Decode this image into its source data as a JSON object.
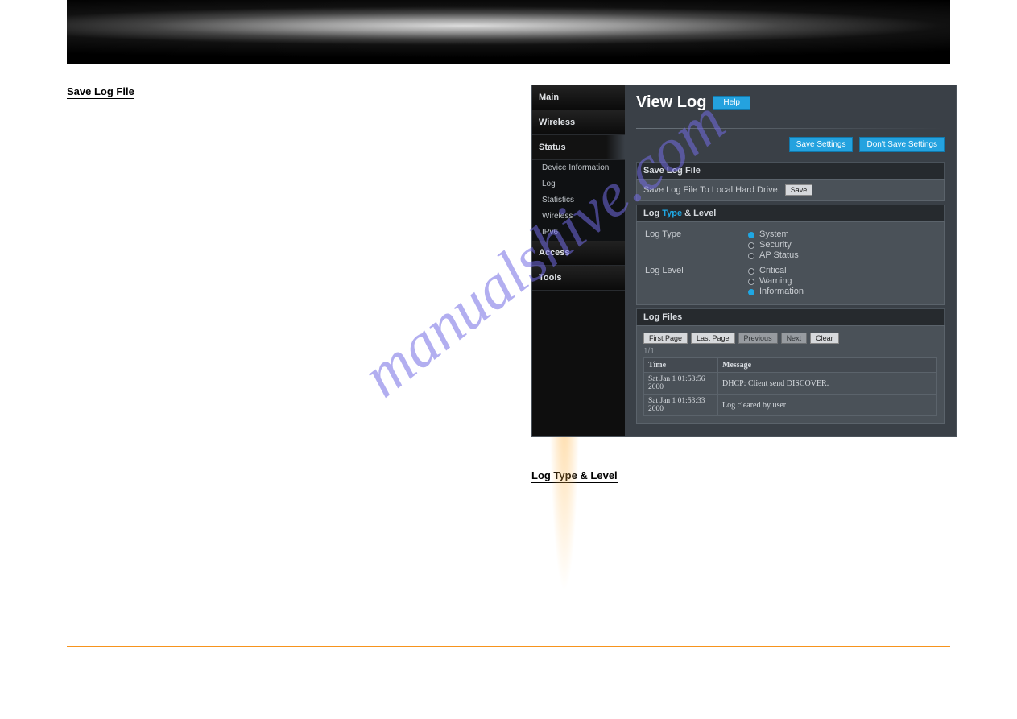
{
  "headings": {
    "left": "Save Log File",
    "right": "Log Type & Level"
  },
  "sidenav": {
    "main": "Main",
    "wireless": "Wireless",
    "status": "Status",
    "access": "Access",
    "tools": "Tools",
    "subs": {
      "device_info": "Device Information",
      "log": "Log",
      "statistics": "Statistics",
      "wireless": "Wireless",
      "ipv6": "IPv6"
    }
  },
  "ui": {
    "title": "View Log",
    "help": "Help",
    "save_settings": "Save Settings",
    "dont_save": "Don't Save Settings",
    "save_log_file_hdr": "Save Log File",
    "save_log_text": "Save Log File To Local Hard Drive.",
    "save_btn": "Save",
    "type_level_hdr_prefix": "Log ",
    "type_level_hdr_accent": "Type",
    "type_level_hdr_suffix": " & Level",
    "log_type_label": "Log Type",
    "log_level_label": "Log Level",
    "types": {
      "system": "System",
      "security": "Security",
      "ap": "AP Status"
    },
    "levels": {
      "critical": "Critical",
      "warning": "Warning",
      "information": "Information"
    },
    "log_files_hdr": "Log Files",
    "pager": {
      "first": "First Page",
      "last": "Last Page",
      "prev": "Previous",
      "next": "Next",
      "clear": "Clear"
    },
    "page_of": "1/1",
    "th_time": "Time",
    "th_msg": "Message",
    "rows": [
      {
        "time": "Sat Jan 1 01:53:56 2000",
        "msg": "DHCP: Client send DISCOVER."
      },
      {
        "time": "Sat Jan 1 01:53:33 2000",
        "msg": "Log cleared by user"
      }
    ]
  }
}
